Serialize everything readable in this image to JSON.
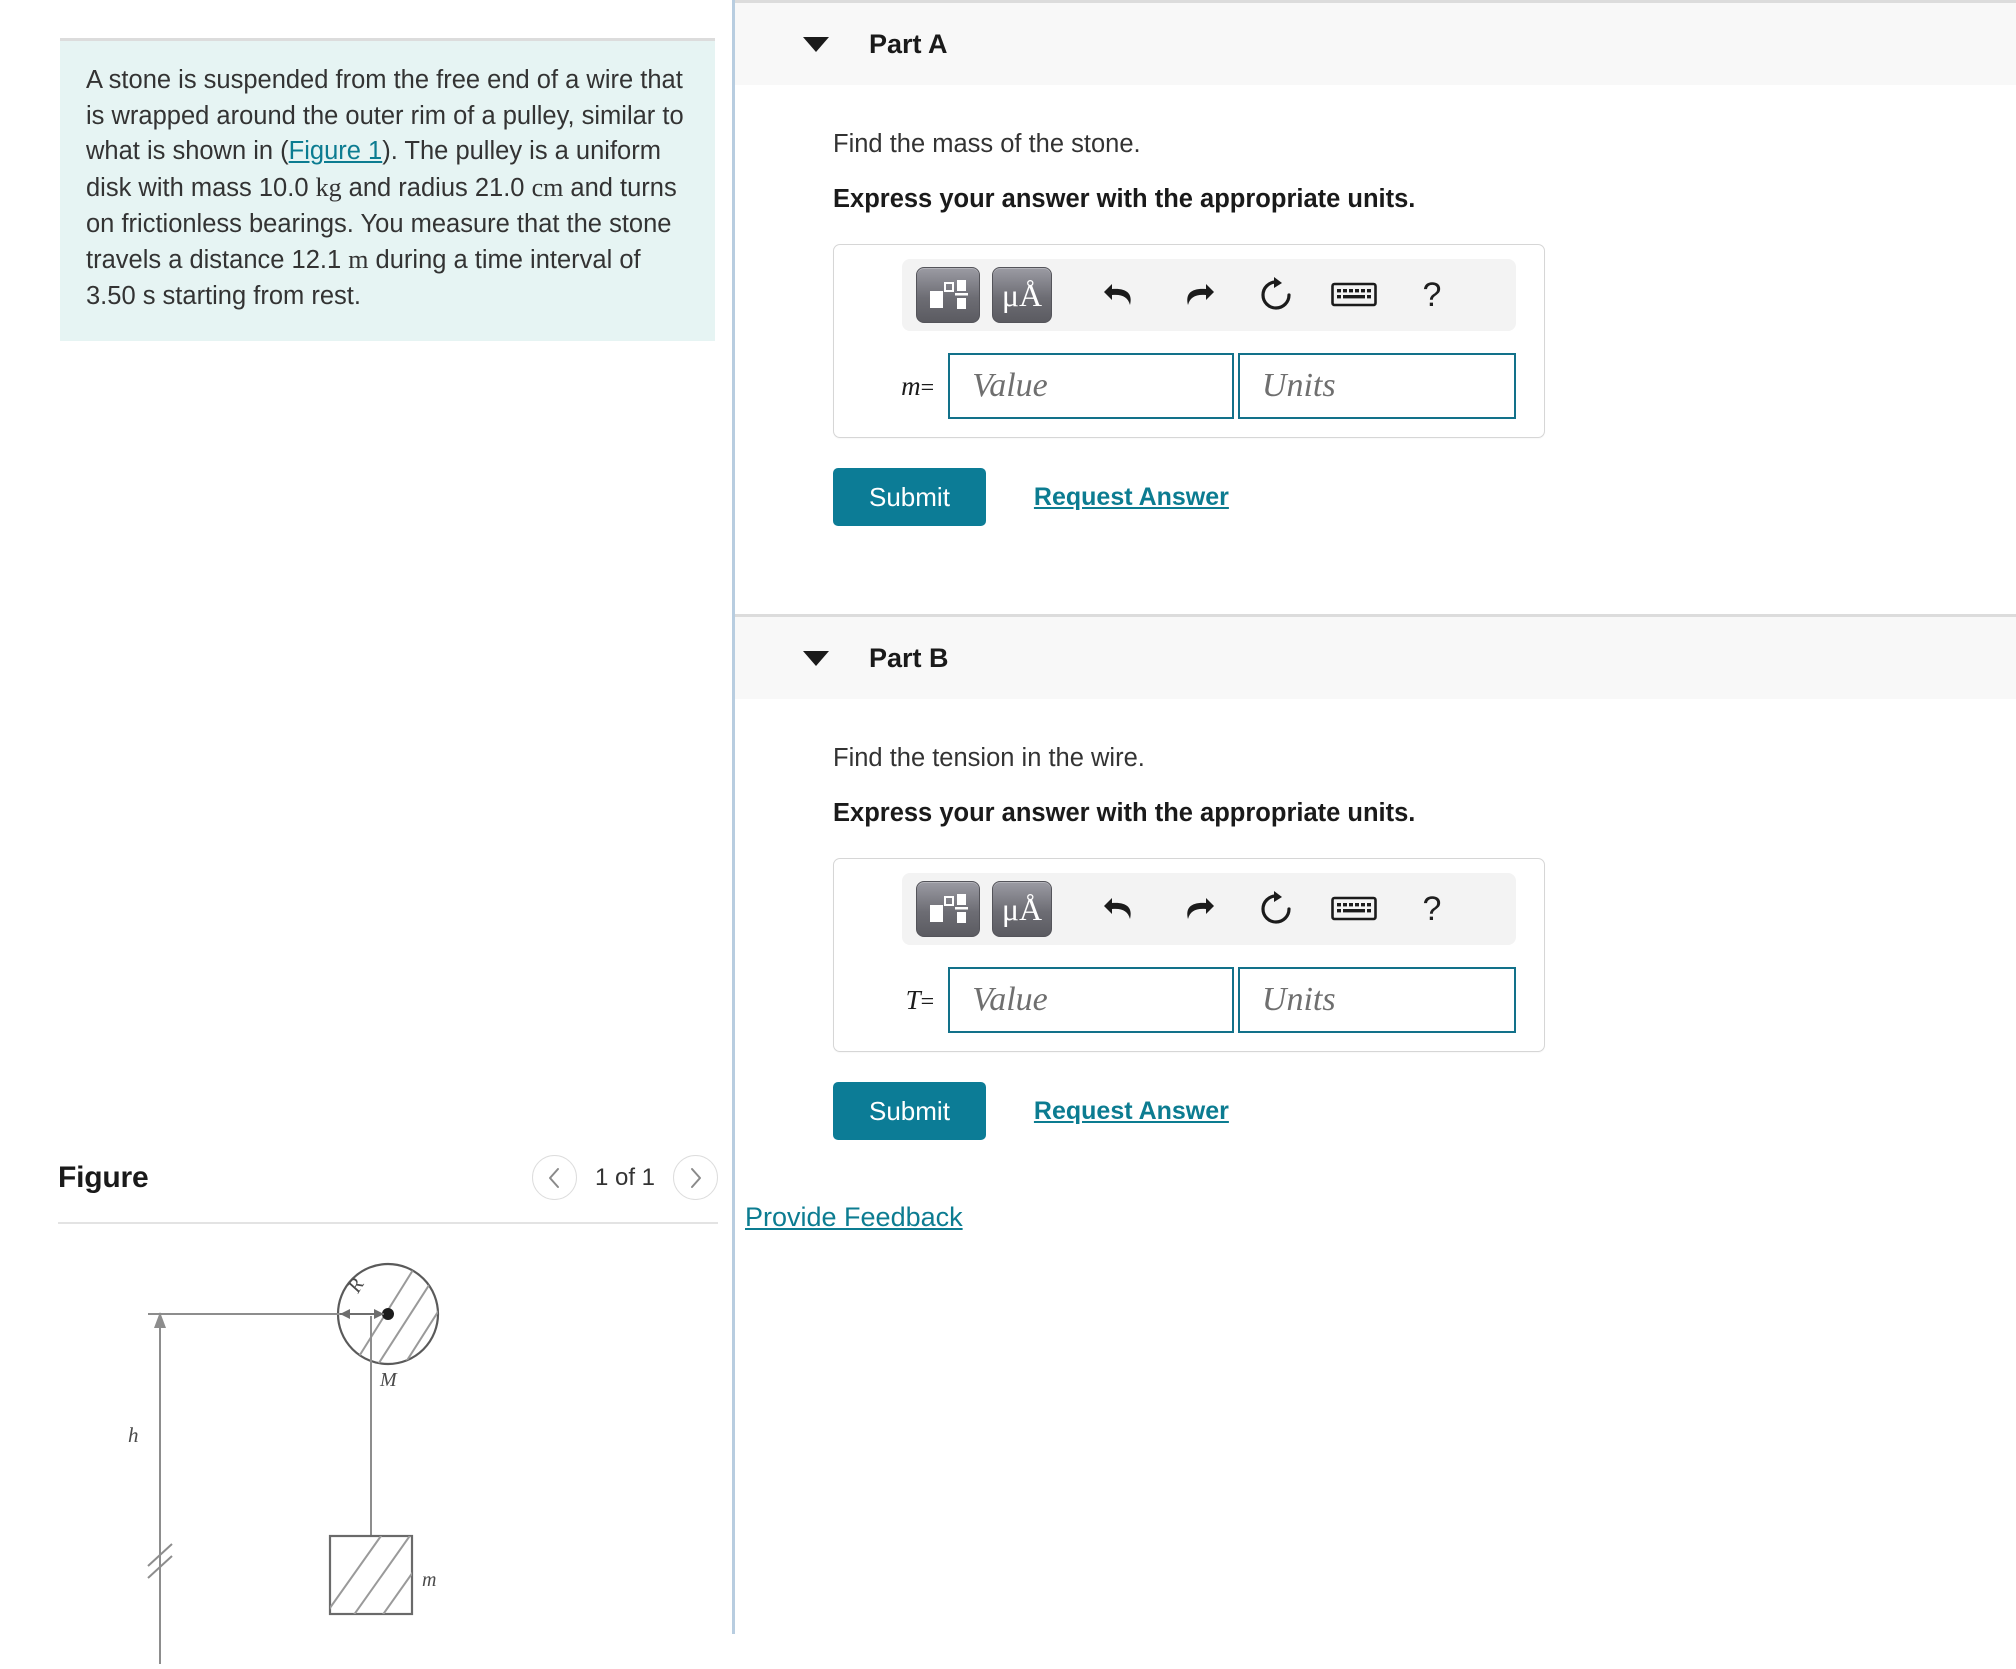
{
  "problem": {
    "text_segments": [
      "A stone is suspended from the free end of a wire that is wrapped around the outer rim of a pulley, similar to what is shown in (",
      "Figure 1",
      "). The pulley is a uniform disk with mass 10.0 ",
      "kg",
      " and radius 21.0 ",
      "cm",
      " and turns on frictionless bearings. You measure that the stone travels a distance 12.1 ",
      "m",
      " during a time interval of 3.50 s starting from rest."
    ],
    "figure_link_label": "Figure 1",
    "values": {
      "pulley_mass": "10.0 kg",
      "pulley_radius": "21.0 cm",
      "distance": "12.1 m",
      "time": "3.50 s",
      "initial_state": "starting from rest"
    }
  },
  "figure": {
    "title": "Figure",
    "pager_label": "1 of 1",
    "prev_icon": "chevron-left-icon",
    "next_icon": "chevron-right-icon",
    "diagram_labels": {
      "radius": "R",
      "pulley_mass": "M",
      "height": "h",
      "block_mass": "m"
    }
  },
  "toolbar": {
    "template_icon": "math-template-icon",
    "units_icon": "micro-angstrom-icon",
    "undo_icon": "undo-icon",
    "redo_icon": "redo-icon",
    "reset_icon": "reset-icon",
    "keyboard_icon": "keyboard-icon",
    "help_icon": "question-mark-icon",
    "help_glyph": "?",
    "units_glyph": "μÅ"
  },
  "parts": [
    {
      "id": "part-a",
      "label": "Part A",
      "prompt": "Find the mass of the stone.",
      "instruction": "Express your answer with the appropriate units.",
      "variable": "m",
      "equals": "=",
      "value_placeholder": "Value",
      "units_placeholder": "Units",
      "value": "",
      "units": "",
      "submit_label": "Submit",
      "request_answer_label": "Request Answer",
      "expanded": true
    },
    {
      "id": "part-b",
      "label": "Part B",
      "prompt": "Find the tension in the wire.",
      "instruction": "Express your answer with the appropriate units.",
      "variable": "T",
      "equals": "=",
      "value_placeholder": "Value",
      "units_placeholder": "Units",
      "value": "",
      "units": "",
      "submit_label": "Submit",
      "request_answer_label": "Request Answer",
      "expanded": true
    }
  ],
  "footer": {
    "feedback_label": "Provide Feedback"
  },
  "colors": {
    "accent_teal": "#0c7c91",
    "submit_teal": "#0c7c96",
    "field_border": "#12718a",
    "problem_bg": "#e6f4f3",
    "part_header_bg": "#f8f8f8",
    "divider_blue": "#b8cde0"
  }
}
